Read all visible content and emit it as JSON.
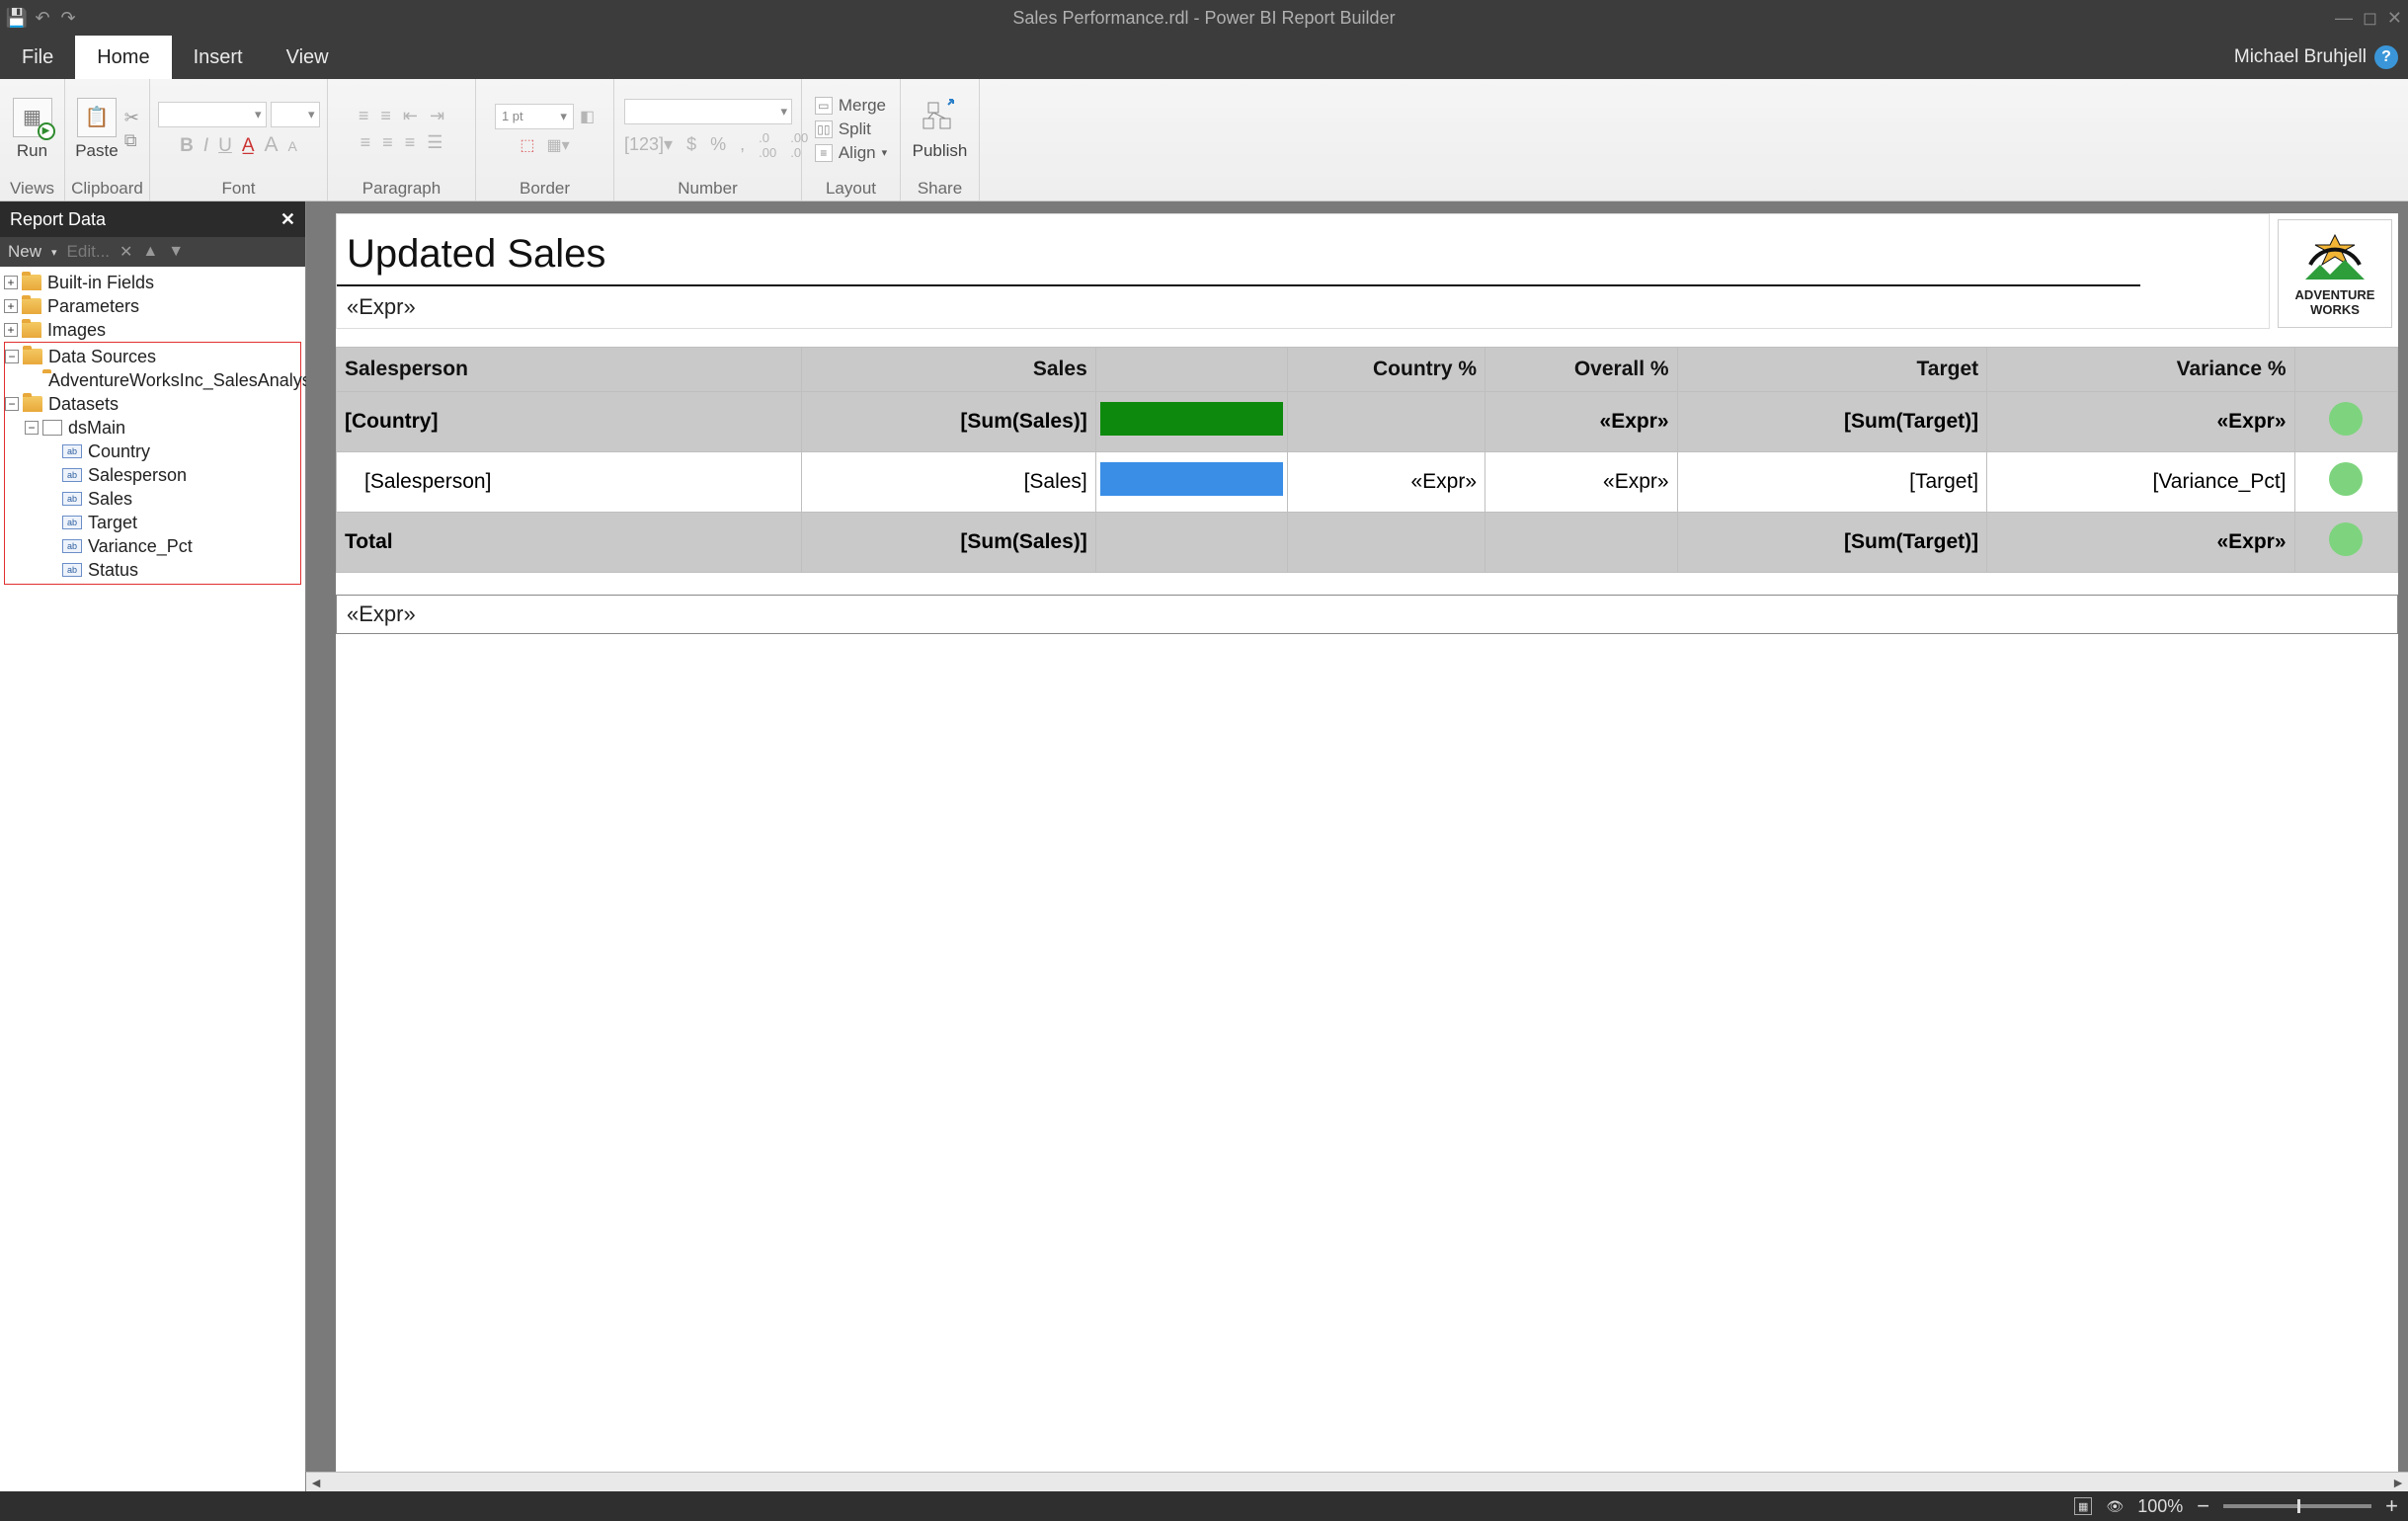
{
  "window": {
    "title": "Sales Performance.rdl - Power BI Report Builder"
  },
  "tabs": {
    "file": "File",
    "home": "Home",
    "insert": "Insert",
    "view": "View",
    "user": "Michael Bruhjell"
  },
  "ribbon": {
    "views": {
      "label": "Views",
      "run": "Run"
    },
    "clipboard": {
      "label": "Clipboard",
      "paste": "Paste"
    },
    "font": {
      "label": "Font"
    },
    "paragraph": {
      "label": "Paragraph"
    },
    "border": {
      "label": "Border",
      "width": "1 pt"
    },
    "number": {
      "label": "Number"
    },
    "layout": {
      "label": "Layout",
      "merge": "Merge",
      "split": "Split",
      "align": "Align"
    },
    "share": {
      "label": "Share",
      "publish": "Publish"
    }
  },
  "reportData": {
    "title": "Report Data",
    "toolbar": {
      "new": "New",
      "edit": "Edit..."
    },
    "tree": {
      "builtin": "Built-in Fields",
      "parameters": "Parameters",
      "images": "Images",
      "dataSources": "Data Sources",
      "ds1": "AdventureWorksInc_SalesAnalysis",
      "datasets": "Datasets",
      "dsMain": "dsMain",
      "fields": {
        "country": "Country",
        "salesperson": "Salesperson",
        "sales": "Sales",
        "target": "Target",
        "variance_pct": "Variance_Pct",
        "status": "Status"
      }
    }
  },
  "report": {
    "title": "Updated Sales",
    "exprTop": "«Expr»",
    "exprBottom": "«Expr»",
    "logo": {
      "line1": "ADVENTURE",
      "line2": "WORKS"
    },
    "table": {
      "headers": {
        "salesperson": "Salesperson",
        "sales": "Sales",
        "bar": "",
        "countryPct": "Country %",
        "overallPct": "Overall %",
        "target": "Target",
        "variancePct": "Variance %",
        "status": ""
      },
      "countryRow": {
        "salesperson": "[Country]",
        "sales": "[Sum(Sales)]",
        "overallPct": "«Expr»",
        "target": "[Sum(Target)]",
        "variancePct": "«Expr»"
      },
      "detailRow": {
        "salesperson": "[Salesperson]",
        "sales": "[Sales]",
        "countryPct": "«Expr»",
        "overallPct": "«Expr»",
        "target": "[Target]",
        "variancePct": "[Variance_Pct]"
      },
      "totalRow": {
        "salesperson": "Total",
        "sales": "[Sum(Sales)]",
        "target": "[Sum(Target)]",
        "variancePct": "«Expr»"
      }
    }
  },
  "statusBar": {
    "zoom": "100%"
  }
}
